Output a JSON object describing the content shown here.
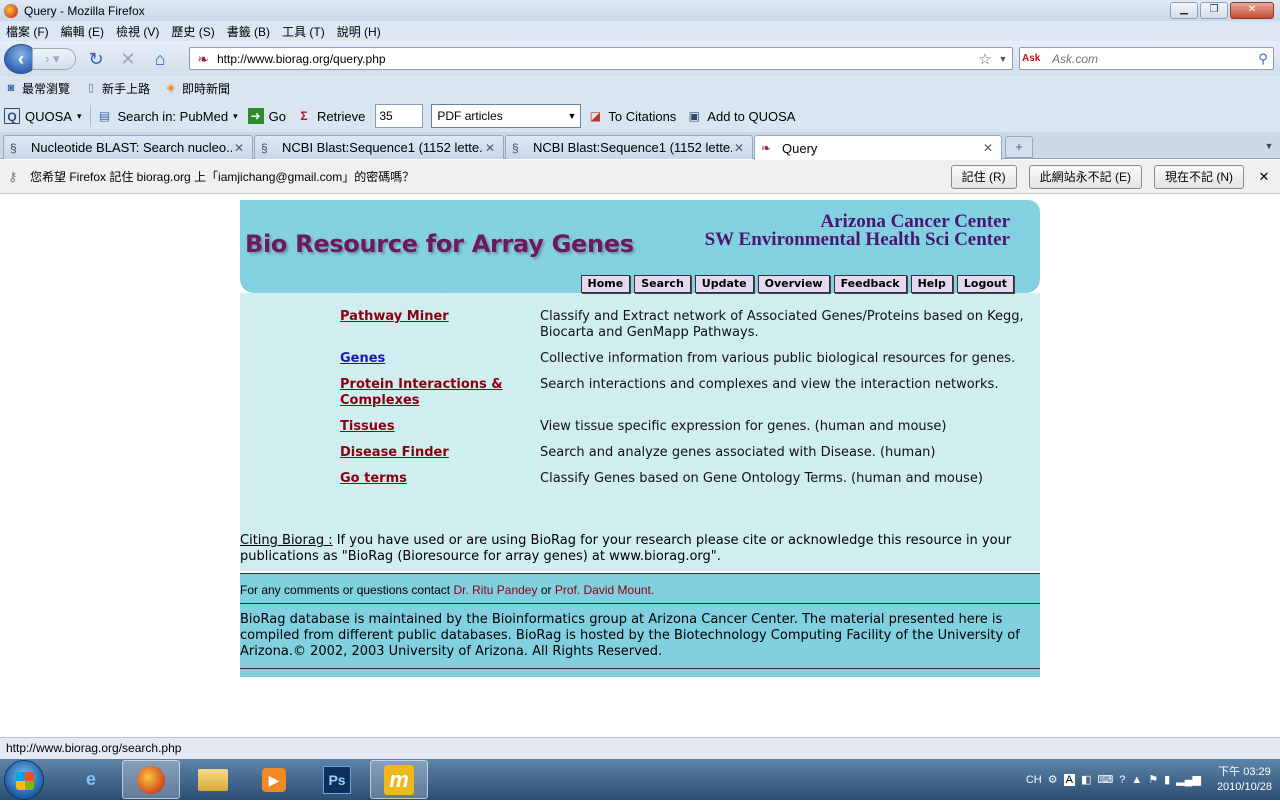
{
  "window": {
    "title": "Query - Mozilla Firefox"
  },
  "menu": [
    "檔案 (F)",
    "編輯 (E)",
    "檢視 (V)",
    "歷史 (S)",
    "書籤 (B)",
    "工具 (T)",
    "說明 (H)"
  ],
  "nav": {
    "url": "http://www.biorag.org/query.php",
    "search_engine": "Ask",
    "search_placeholder": "Ask.com"
  },
  "bookmarks": [
    {
      "label": "最常瀏覽",
      "icon": "most-visited-icon"
    },
    {
      "label": "新手上路",
      "icon": "page-icon"
    },
    {
      "label": "即時新聞",
      "icon": "rss-icon"
    }
  ],
  "quosa": {
    "brand": "QUOSA",
    "search_in": "Search in: PubMed",
    "go": "Go",
    "retrieve": "Retrieve",
    "retrieve_count": "35",
    "select": "PDF articles",
    "to_citations": "To Citations",
    "add": "Add to QUOSA"
  },
  "tabs": [
    {
      "label": "Nucleotide BLAST: Search nucleo...",
      "active": false
    },
    {
      "label": "NCBI Blast:Sequence1 (1152 lette...",
      "active": false
    },
    {
      "label": "NCBI Blast:Sequence1 (1152 lette...",
      "active": false
    },
    {
      "label": "Query",
      "active": true
    }
  ],
  "notification": {
    "message": "您希望 Firefox 記住 biorag.org 上「iamjichang@gmail.com」的密碼嗎？",
    "remember": "記住 (R)",
    "never": "此網站永不記 (E)",
    "not_now": "現在不記 (N)"
  },
  "banner": {
    "title": "Bio Resource for Array Genes",
    "org1": "Arizona Cancer Center",
    "org2": "SW Environmental Health Sci Center",
    "nav": [
      "Home",
      "Search",
      "Update",
      "Overview",
      "Feedback",
      "Help",
      "Logout"
    ]
  },
  "resources": [
    {
      "name": "Pathway Miner",
      "desc": "Classify and Extract network of Associated Genes/Proteins based on Kegg, Biocarta and GenMapp Pathways."
    },
    {
      "name": "Genes",
      "desc": "Collective information from various public biological resources for genes."
    },
    {
      "name": "Protein Interactions & Complexes",
      "desc": "Search interactions and complexes and view the interaction networks."
    },
    {
      "name": "Tissues",
      "desc": "View tissue specific expression for genes. (human and mouse)"
    },
    {
      "name": "Disease Finder",
      "desc": "Search and analyze genes associated with Disease. (human)"
    },
    {
      "name": "Go terms",
      "desc": "Classify Genes based on Gene Ontology Terms. (human and mouse)"
    }
  ],
  "citing": {
    "label": "Citing Biorag :",
    "text": " If you have used or are using BioRag for your research please cite or acknowledge this resource in your publications as \"BioRag (Bioresource for array genes) at www.biorag.org\"."
  },
  "contact": {
    "prefix": "For any comments or questions contact ",
    "person1": "Dr. Ritu Pandey",
    "or": " or ",
    "person2": "Prof. David Mount."
  },
  "footer_text": "BioRag database is maintained by the Bioinformatics group at Arizona Cancer Center. The material presented here is compiled from different public databases. BioRag is hosted by the Biotechnology Computing Facility of the University of Arizona.© 2002, 2003 University of Arizona. All Rights Reserved.",
  "status": "http://www.biorag.org/search.php",
  "taskbar": {
    "apps": [
      "internet-explorer-icon",
      "firefox-icon",
      "file-explorer-icon",
      "media-player-icon",
      "photoshop-icon",
      "m-app-icon"
    ],
    "ps_label": "Ps",
    "m_label": "m",
    "lang": "CH",
    "time": "下午 03:29",
    "date": "2010/10/28"
  },
  "colors": {
    "banner": "#80d0e0",
    "content": "#d0eef0",
    "title": "#6b1a5c",
    "link": "#8b0010",
    "link_blue": "#1a1ab0"
  }
}
